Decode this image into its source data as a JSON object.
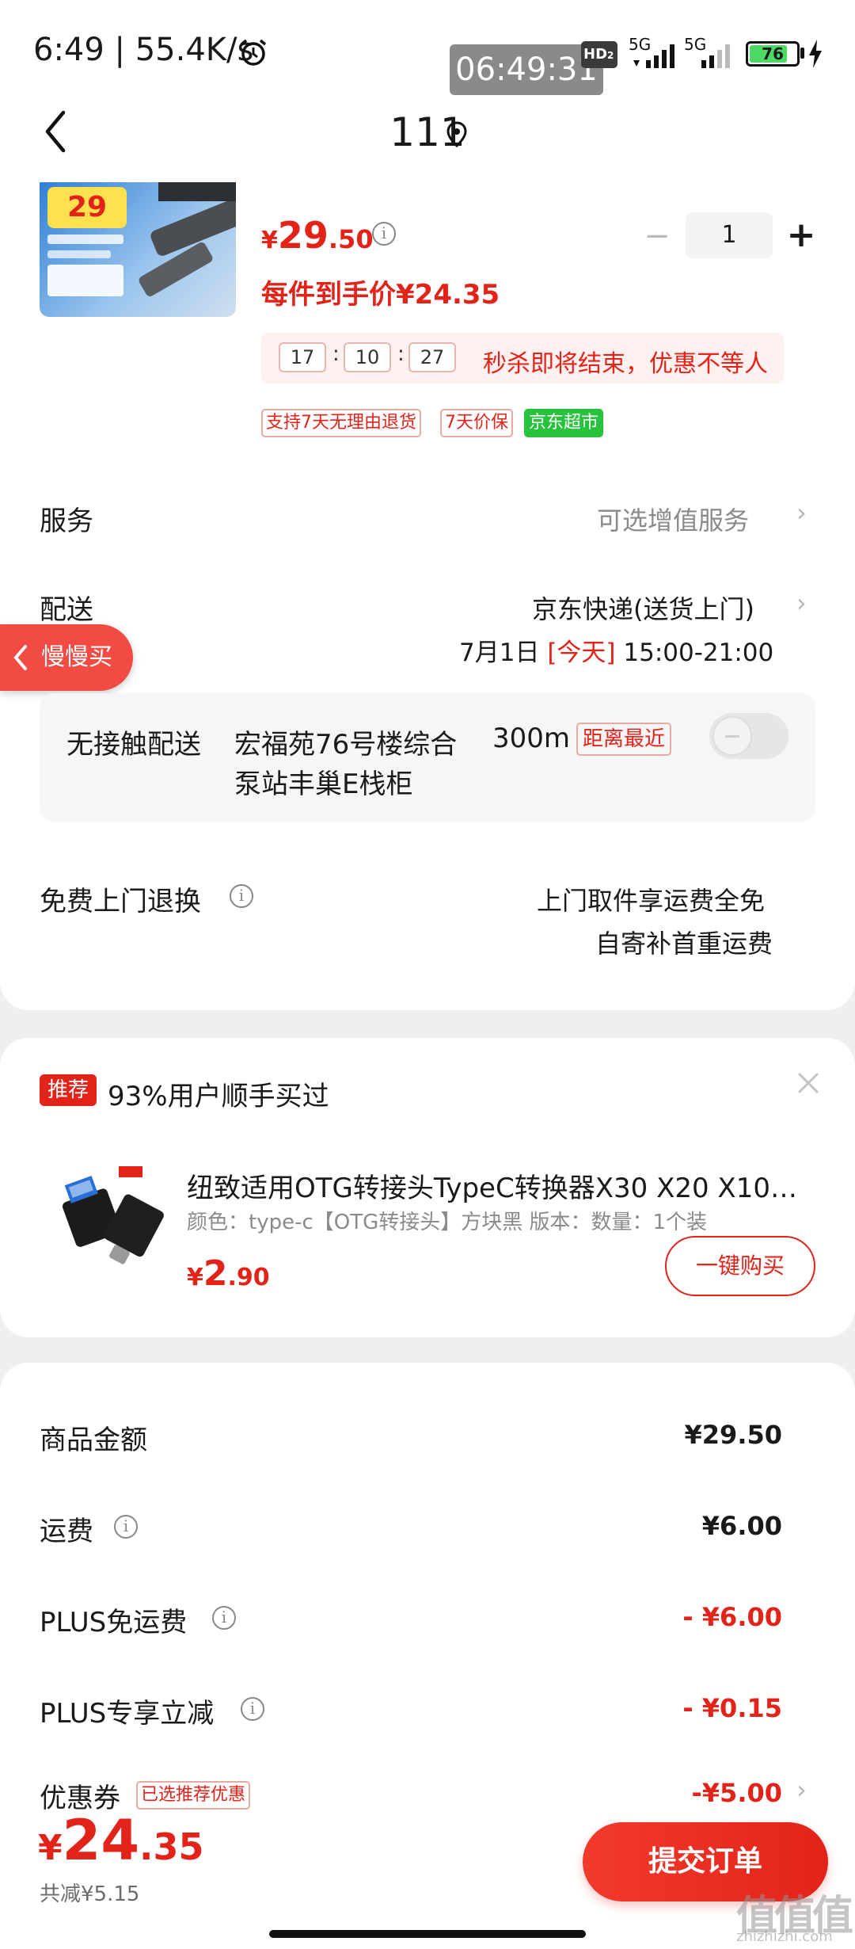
{
  "status_bar": {
    "time": "6:49",
    "net_speed": "55.4K/s",
    "overlay_clock": "06:49:31",
    "hd_label": "HD",
    "hd_sub": "2",
    "net1": "5G",
    "net2": "5G",
    "battery": "76"
  },
  "header": {
    "title": "111"
  },
  "product": {
    "price_currency": "¥",
    "price_int": "29",
    "price_dec": ".50",
    "quantity": "1",
    "minus": "−",
    "plus": "+",
    "each_price": "每件到手价¥24.35",
    "countdown": {
      "h": "17",
      "m": "10",
      "s": "27",
      "colon": ":",
      "text": "秒杀即将结束，优惠不等人"
    },
    "tags": [
      "支持7天无理由退货",
      "7天价保",
      "京东超市"
    ],
    "thumb_badge": "29"
  },
  "service": {
    "label": "服务",
    "value": "可选增值服务",
    "chevron": "›"
  },
  "delivery": {
    "label": "配送",
    "carrier": "京东快递(送货上门)",
    "date_prefix": "7月1日 ",
    "date_today": "[今天]",
    "date_time": " 15:00-21:00",
    "chevron": "›"
  },
  "float_button": {
    "label": "慢慢买"
  },
  "contactless": {
    "label": "无接触配送",
    "addr_line1": "宏福苑76号楼综合",
    "addr_line2": "泵站丰巢E栈柜",
    "distance": "300m",
    "nearest": "距离最近"
  },
  "returns": {
    "label": "免费上门退换",
    "line1": "上门取件享运费全免",
    "line2": "自寄补首重运费",
    "info": "i"
  },
  "recommend": {
    "badge": "推荐",
    "title": "93%用户顺手买过",
    "close": "×",
    "name": "纽致适用OTG转接头TypeC转换器X30 X20 X10…",
    "spec": "颜色：type-c【OTG转接头】方块黑   版本：数量：1个装",
    "price_currency": "¥",
    "price_int": "2",
    "price_dec": ".90",
    "buy_label": "一键购买"
  },
  "summary": {
    "rows": [
      {
        "label": "商品金额",
        "value": "¥29.50",
        "red": false,
        "info": false
      },
      {
        "label": "运费",
        "value": "¥6.00",
        "red": false,
        "info": true
      },
      {
        "label": "PLUS免运费",
        "value": "- ¥6.00",
        "red": true,
        "info": true
      },
      {
        "label": "PLUS专享立减",
        "value": "- ¥0.15",
        "red": true,
        "info": true
      }
    ],
    "coupon_label": "优惠券",
    "coupon_tag": "已选推荐优惠",
    "coupon_value": "-¥5.00",
    "chevron": "›"
  },
  "bottom": {
    "total_currency": "¥",
    "total_int": "24",
    "total_dec": ".35",
    "saved": "共减¥5.15",
    "submit_label": "提交订单",
    "watermark": "值值值",
    "watermark_sub": "zhizhizhi.com"
  },
  "colors": {
    "accent": "#e2231a",
    "green_tag": "#27c33d",
    "page_bg": "#efefef"
  }
}
